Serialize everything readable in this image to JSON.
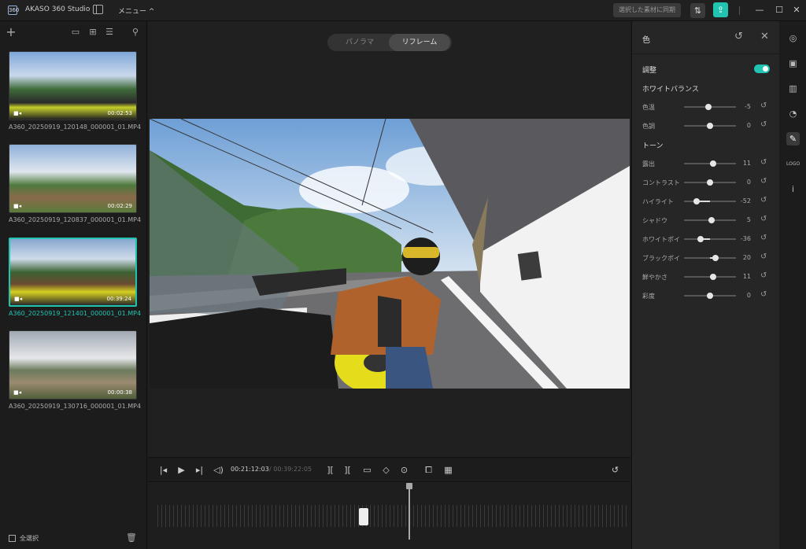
{
  "app": {
    "title": "AKASO 360 Studio",
    "logo_text": "360",
    "menu_label": "メニュー ^",
    "sync_button": "選択した素材に同期",
    "swap_icon": "⇅",
    "export_icon": "⇪",
    "minimize_icon": "—",
    "maximize_icon": "☐",
    "close_icon": "✕"
  },
  "library": {
    "add_icon": "+",
    "view_large_icon": "▭",
    "view_grid_icon": "⊞",
    "view_list_icon": "☰",
    "filter_icon": "⚲",
    "items": [
      {
        "name": "A360_20250919_120148_000001_01.MP4",
        "duration": "00:02:53",
        "selected": false
      },
      {
        "name": "A360_20250919_120837_000001_01.MP4",
        "duration": "00:02:29",
        "selected": false
      },
      {
        "name": "A360_20250919_121401_000001_01.MP4",
        "duration": "00:39:24",
        "selected": true
      },
      {
        "name": "A360_20250919_130716_000001_01.MP4",
        "duration": "00:00:38",
        "selected": false
      }
    ],
    "camera_glyph": "■◂",
    "select_all": "全選択",
    "trash_icon": "🗑"
  },
  "viewer": {
    "modes": [
      "パノラマ",
      "リフレーム"
    ],
    "active_mode": "リフレーム"
  },
  "playback": {
    "current_time": "00:21:12:03",
    "total_time": "/ 00:39:22:05",
    "icons": {
      "prev": "|◂",
      "play": "▶",
      "next": "▸|",
      "volume": "◁)",
      "split_in": "][",
      "split_out": "][",
      "aspect": "▭",
      "keyframe": "◇",
      "target": "⊙",
      "crop": "⧠",
      "grid": "▦",
      "reset": "↺"
    }
  },
  "color_panel": {
    "title": "色",
    "reset_icon": "↺",
    "close_icon": "✕",
    "adjust_label": "調整",
    "adjust_enabled": true,
    "white_balance_label": "ホワイトバランス",
    "tone_label": "トーン",
    "white_balance": [
      {
        "label": "色温",
        "value": "-5",
        "level": -0.05
      },
      {
        "label": "色調",
        "value": "0",
        "level": 0
      }
    ],
    "tone": [
      {
        "label": "露出",
        "value": "11",
        "level": 0.11
      },
      {
        "label": "コントラスト",
        "value": "0",
        "level": 0
      },
      {
        "label": "ハイライト",
        "value": "-52",
        "level": -0.52
      },
      {
        "label": "シャドウ",
        "value": "5",
        "level": 0.05
      },
      {
        "label": "ホワイトポイ",
        "value": "-36",
        "level": -0.36
      },
      {
        "label": "ブラックポイ",
        "value": "20",
        "level": 0.2
      },
      {
        "label": "鮮やかさ",
        "value": "11",
        "level": 0.11
      },
      {
        "label": "彩度",
        "value": "0",
        "level": 0
      }
    ]
  },
  "side_rail": {
    "icons": [
      "◎",
      "▣",
      "▥",
      "◔",
      "✎",
      "LOGO",
      "i"
    ],
    "icon_names": [
      "camera-icon",
      "image-icon",
      "film-icon",
      "speed-icon",
      "color-icon",
      "logo-icon",
      "info-icon"
    ],
    "active_index": 4
  }
}
